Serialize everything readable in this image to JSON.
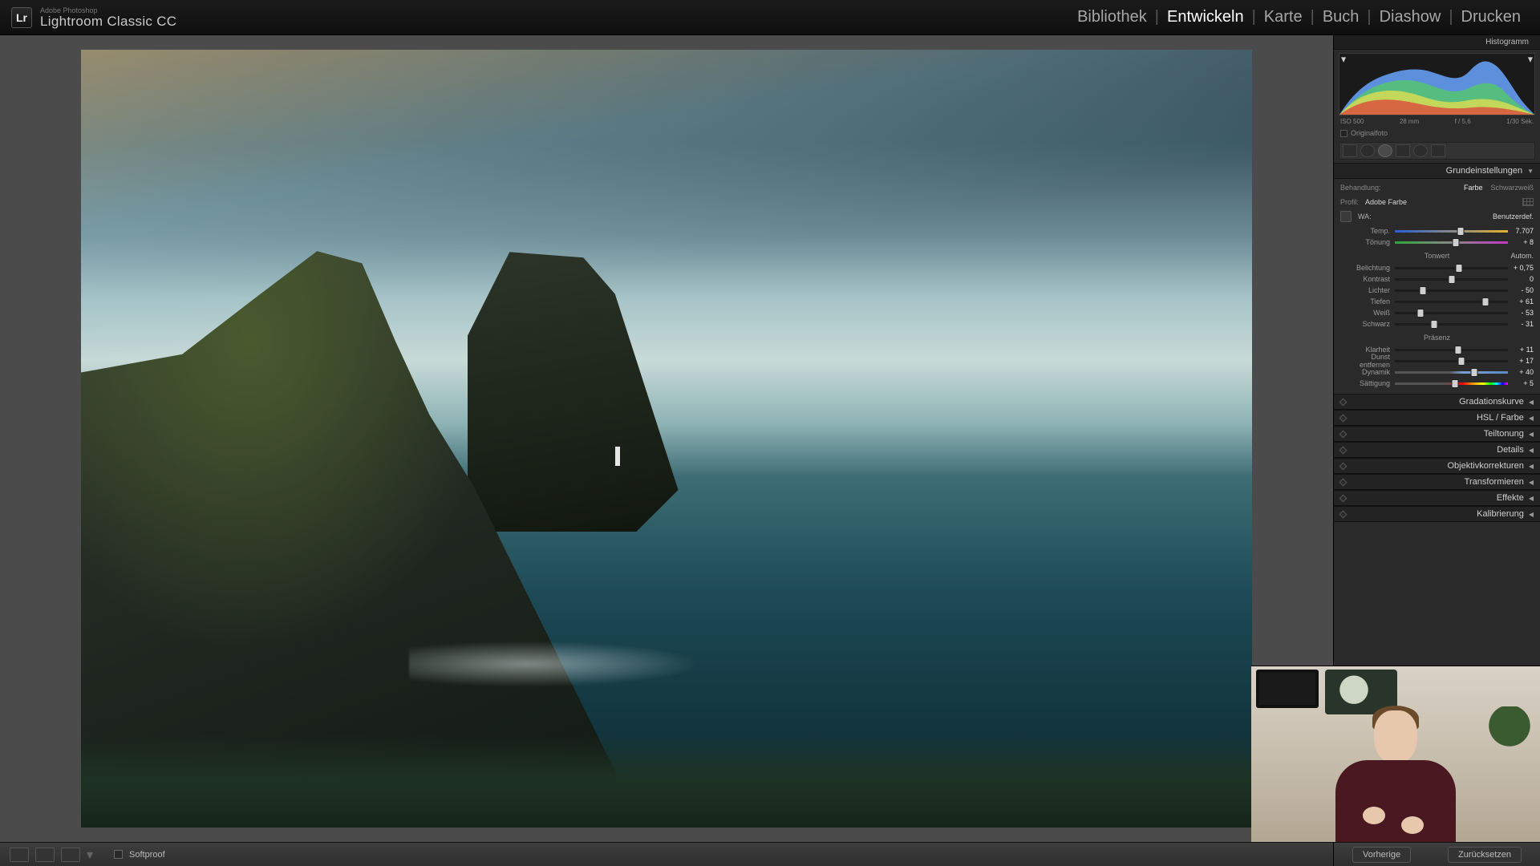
{
  "app": {
    "subtitle": "Adobe Photoshop",
    "title": "Lightroom Classic CC"
  },
  "modules": {
    "items": [
      "Bibliothek",
      "Entwickeln",
      "Karte",
      "Buch",
      "Diashow",
      "Drucken"
    ],
    "active_index": 1
  },
  "histogram": {
    "title": "Histogramm",
    "iso": "ISO 500",
    "focal": "28 mm",
    "aperture": "f / 5,6",
    "shutter": "1/30 Sek.",
    "original_checkbox": "Originalfoto"
  },
  "basic": {
    "title": "Grundeinstellungen",
    "treatment_label": "Behandlung:",
    "treatment_tabs": {
      "color": "Farbe",
      "bw": "Schwarzweiß"
    },
    "profile_label": "Profil:",
    "profile_value": "Adobe Farbe",
    "wb_label": "WA:",
    "wb_value": "Benutzerdef.",
    "sliders_wb": [
      {
        "label": "Temp.",
        "value": "7.707",
        "pos": 58,
        "grad": "grad-temp"
      },
      {
        "label": "Tönung",
        "value": "+ 8",
        "pos": 54,
        "grad": "grad-tint"
      }
    ],
    "tone_header": "Tonwert",
    "auto_label": "Autom.",
    "sliders_tone": [
      {
        "label": "Belichtung",
        "value": "+ 0,75",
        "pos": 57
      },
      {
        "label": "Kontrast",
        "value": "0",
        "pos": 50
      },
      {
        "label": "Lichter",
        "value": "- 50",
        "pos": 25
      },
      {
        "label": "Tiefen",
        "value": "+ 61",
        "pos": 80
      },
      {
        "label": "Weiß",
        "value": "- 53",
        "pos": 23
      },
      {
        "label": "Schwarz",
        "value": "- 31",
        "pos": 35
      }
    ],
    "presence_header": "Präsenz",
    "sliders_presence": [
      {
        "label": "Klarheit",
        "value": "+ 11",
        "pos": 56
      },
      {
        "label": "Dunst entfernen",
        "value": "+ 17",
        "pos": 59
      },
      {
        "label": "Dynamik",
        "value": "+ 40",
        "pos": 70,
        "grad": "grad-vib"
      },
      {
        "label": "Sättigung",
        "value": "+ 5",
        "pos": 53,
        "grad": "grad-sat"
      }
    ]
  },
  "collapsed_panels": [
    "Gradationskurve",
    "HSL / Farbe",
    "Teiltonung",
    "Details",
    "Objektivkorrekturen",
    "Transformieren",
    "Effekte",
    "Kalibrierung"
  ],
  "bottombar": {
    "softproof": "Softproof"
  },
  "right_buttons": {
    "prev": "Vorherige",
    "reset": "Zurücksetzen"
  }
}
